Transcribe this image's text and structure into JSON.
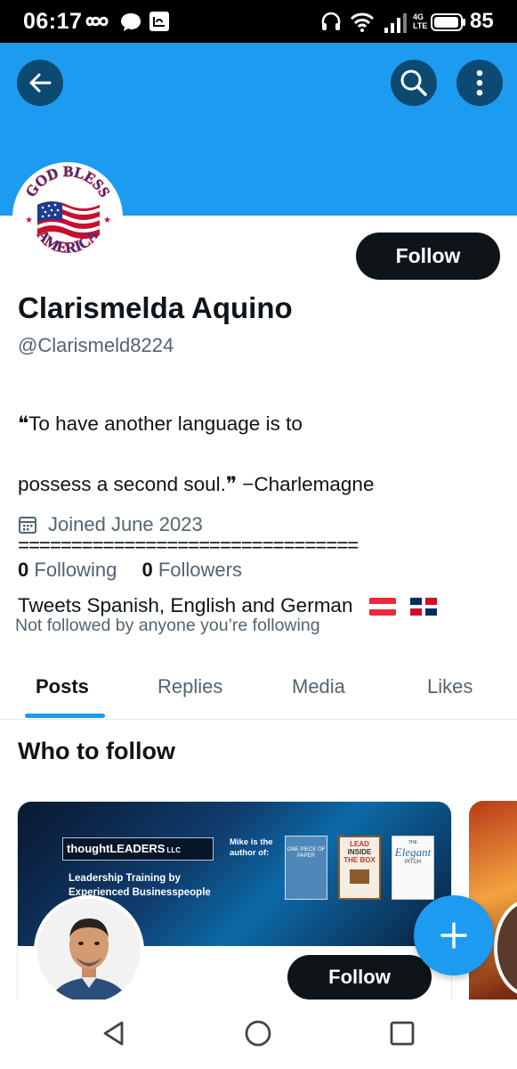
{
  "status_bar": {
    "time": "06:17",
    "network": "4G LTE",
    "battery": "85",
    "icons": [
      "infinity-icon",
      "chat-bubble-icon",
      "app-notification-icon",
      "headset-icon",
      "wifi-icon",
      "signal-icon",
      "battery-icon"
    ]
  },
  "header": {
    "back_icon": "arrow-left-icon",
    "search_icon": "search-icon",
    "more_icon": "more-vertical-icon",
    "banner_color": "#1d9bf0"
  },
  "profile": {
    "avatar_text_top": "GOD BLESS",
    "avatar_text_bottom": "AMERICA",
    "follow_label": "Follow",
    "display_name": "Clarismelda Aquino",
    "handle": "@Clarismeld8224",
    "bio_line1": "❝To have another language is to",
    "bio_line2": "possess a second soul.❞ −Charlemagne",
    "bio_line3": "================================",
    "bio_line4": "Tweets Spanish, English and German",
    "bio_flags": [
      "austria-flag-icon",
      "dominican-republic-flag-icon"
    ],
    "joined": "Joined June 2023",
    "following_count": "0",
    "following_label": "Following",
    "followers_count": "0",
    "followers_label": "Followers",
    "not_followed_text": "Not followed by anyone you’re following"
  },
  "tabs": [
    {
      "label": "Posts",
      "active": true
    },
    {
      "label": "Replies",
      "active": false
    },
    {
      "label": "Media",
      "active": false
    },
    {
      "label": "Likes",
      "active": false
    }
  ],
  "who_to_follow": {
    "title": "Who to follow",
    "card": {
      "banner_logo": "thoughtLEADERS",
      "banner_logo_suffix": "LLC",
      "banner_sub1": "Leadership Training by",
      "banner_sub2": "Experienced Businesspeople",
      "banner_mike1": "Mike is the",
      "banner_mike2": "author of:",
      "book1": "ONE PIECE OF PAPER",
      "book2_l1": "LEAD",
      "book2_l2": "INSIDE",
      "book2_l3": "THE BOX",
      "book3_l1": "THE",
      "book3_l2": "Elegant",
      "book3_l3": "PITCH",
      "follow_label": "Follow"
    }
  },
  "fab": {
    "icon": "plus-icon"
  },
  "navbar": {
    "icons": [
      "back-triangle-icon",
      "home-circle-icon",
      "recents-square-icon"
    ]
  }
}
